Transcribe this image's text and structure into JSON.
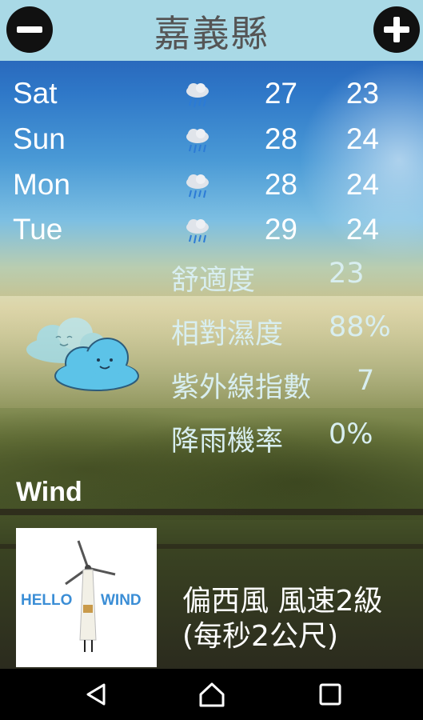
{
  "header": {
    "city": "嘉義縣",
    "left_icon": "minus-circle-icon",
    "right_icon": "plus-circle-icon"
  },
  "forecast": [
    {
      "day": "Sat",
      "icon": "rain-cloud-icon",
      "high": "27",
      "low": "23"
    },
    {
      "day": "Sun",
      "icon": "rain-cloud-icon",
      "high": "28",
      "low": "24"
    },
    {
      "day": "Mon",
      "icon": "rain-cloud-icon",
      "high": "28",
      "low": "24"
    },
    {
      "day": "Tue",
      "icon": "rain-cloud-icon",
      "high": "29",
      "low": "24"
    }
  ],
  "stats": [
    {
      "label": "舒適度",
      "value": "23"
    },
    {
      "label": "相對濕度",
      "value": "88%"
    },
    {
      "label": "紫外線指數",
      "value": "7"
    },
    {
      "label": "降雨機率",
      "value": "0%"
    }
  ],
  "current_icon": "cloudy-icon",
  "wind": {
    "heading": "Wind",
    "image_text_left": "HELLO",
    "image_text_right": "WIND",
    "description_line1": "偏西風 風速2級",
    "description_line2": "(每秒2公尺)"
  },
  "nav": {
    "back_icon": "back-triangle-icon",
    "home_icon": "home-icon",
    "recents_icon": "recents-square-icon"
  },
  "colors": {
    "header_bg": "#a9d9e6",
    "title_text": "#555555",
    "cloud_blue": "#5cc3e8"
  }
}
